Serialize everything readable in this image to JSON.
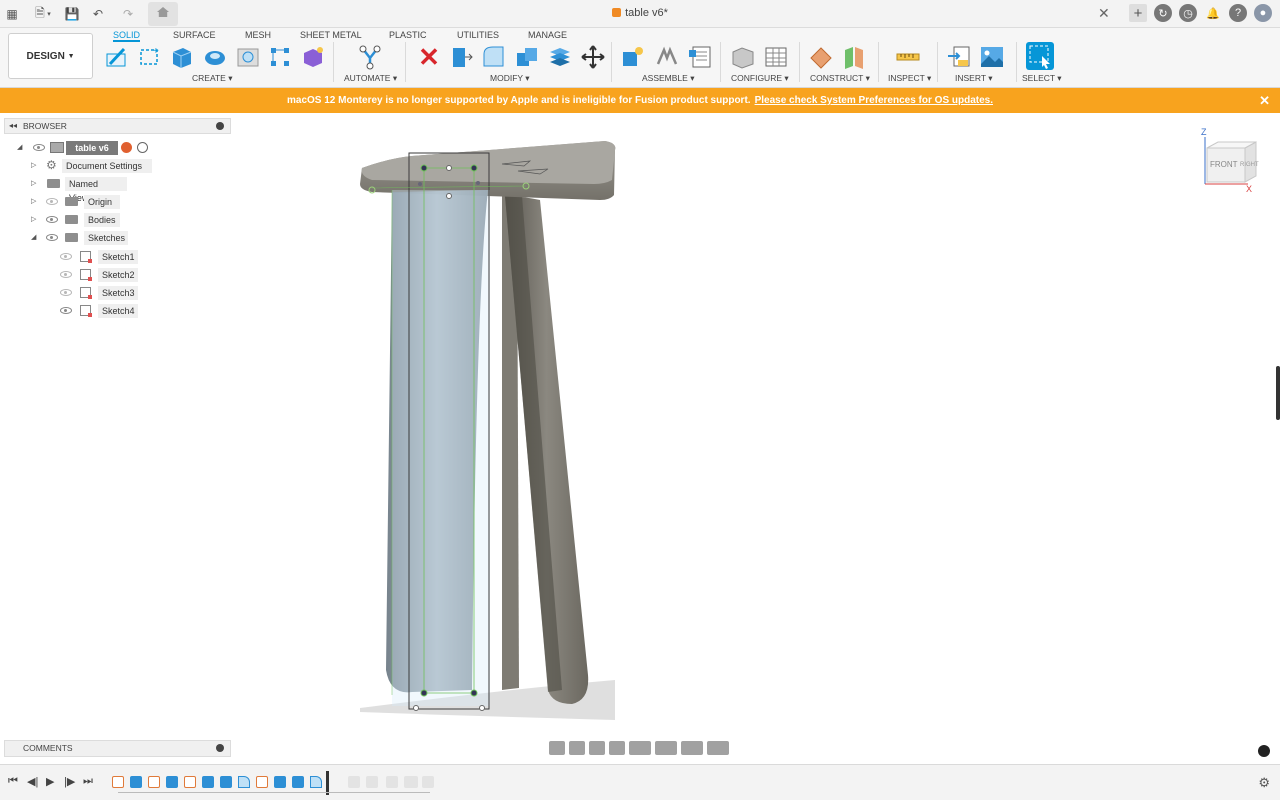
{
  "titlebar": {
    "title": "table v6*",
    "icons": [
      "grid-icon",
      "file-icon",
      "save-icon",
      "undo-icon",
      "redo-icon",
      "home-icon"
    ],
    "right_icons": [
      "new-tab-plus-icon",
      "extensions-icon",
      "job-status-icon",
      "notifications-icon",
      "help-icon",
      "profile-avatar-icon"
    ]
  },
  "ribbon": {
    "workspace": "DESIGN",
    "tabs": [
      "SOLID",
      "SURFACE",
      "MESH",
      "SHEET METAL",
      "PLASTIC",
      "UTILITIES",
      "MANAGE"
    ],
    "active_tab": "SOLID",
    "groups": {
      "create": "CREATE",
      "automate": "AUTOMATE",
      "modify": "MODIFY",
      "assemble": "ASSEMBLE",
      "configure": "CONFIGURE",
      "construct": "CONSTRUCT",
      "inspect": "INSPECT",
      "insert": "INSERT",
      "select": "SELECT"
    },
    "accent": "#0696d7"
  },
  "banner": {
    "message": "macOS 12 Monterey is no longer supported by Apple and is ineligible for Fusion product support.",
    "link": "Please check System Preferences for OS updates.",
    "color": "#f8a31e"
  },
  "browser": {
    "title": "BROWSER",
    "root": "table v6",
    "items": [
      {
        "label": "Document Settings"
      },
      {
        "label": "Named Views"
      },
      {
        "label": "Origin"
      },
      {
        "label": "Bodies"
      },
      {
        "label": "Sketches"
      }
    ],
    "sketches": [
      "Sketch1",
      "Sketch2",
      "Sketch3",
      "Sketch4"
    ]
  },
  "viewcube": {
    "front": "FRONT",
    "right": "RIGHT",
    "axis_z": "Z",
    "axis_x": "X"
  },
  "comments": {
    "title": "COMMENTS"
  }
}
